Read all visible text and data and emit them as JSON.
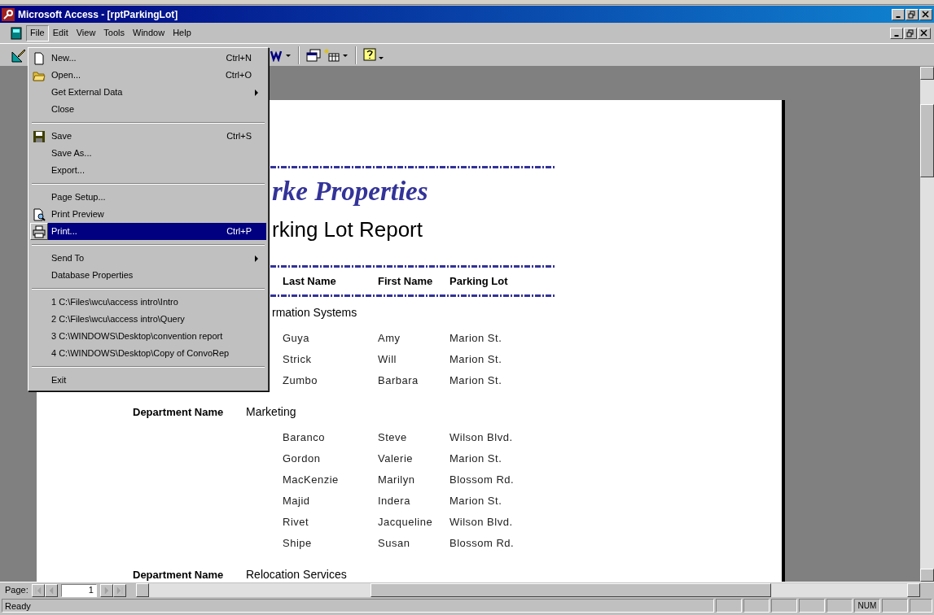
{
  "window": {
    "title": "Microsoft Access - [rptParkingLot]"
  },
  "menubar": [
    {
      "label": "File",
      "selected": true
    },
    {
      "label": "Edit",
      "selected": false
    },
    {
      "label": "View",
      "selected": false
    },
    {
      "label": "Tools",
      "selected": false
    },
    {
      "label": "Window",
      "selected": false
    },
    {
      "label": "Help",
      "selected": false
    }
  ],
  "file_menu": [
    {
      "kind": "item",
      "label": "New...",
      "shortcut": "Ctrl+N",
      "selected": false
    },
    {
      "kind": "item",
      "label": "Open...",
      "shortcut": "Ctrl+O",
      "selected": false
    },
    {
      "kind": "item",
      "label": "Get External Data",
      "submenu": true,
      "selected": false
    },
    {
      "kind": "item",
      "label": "Close",
      "selected": false
    },
    {
      "kind": "separator"
    },
    {
      "kind": "item",
      "label": "Save",
      "shortcut": "Ctrl+S",
      "selected": false
    },
    {
      "kind": "item",
      "label": "Save As...",
      "selected": false
    },
    {
      "kind": "item",
      "label": "Export...",
      "selected": false
    },
    {
      "kind": "separator"
    },
    {
      "kind": "item",
      "label": "Page Setup...",
      "selected": false
    },
    {
      "kind": "item",
      "label": "Print Preview",
      "selected": false
    },
    {
      "kind": "item",
      "label": "Print...",
      "shortcut": "Ctrl+P",
      "selected": true
    },
    {
      "kind": "separator"
    },
    {
      "kind": "item",
      "label": "Send To",
      "submenu": true,
      "selected": false
    },
    {
      "kind": "item",
      "label": "Database Properties",
      "selected": false
    },
    {
      "kind": "separator"
    },
    {
      "kind": "item",
      "label": "1 C:\\Files\\wcu\\access intro\\Intro",
      "selected": false
    },
    {
      "kind": "item",
      "label": "2 C:\\Files\\wcu\\access intro\\Query",
      "selected": false
    },
    {
      "kind": "item",
      "label": "3 C:\\WINDOWS\\Desktop\\convention report",
      "selected": false
    },
    {
      "kind": "item",
      "label": "4 C:\\WINDOWS\\Desktop\\Copy of ConvoRep",
      "selected": false
    },
    {
      "kind": "separator"
    },
    {
      "kind": "item",
      "label": "Exit",
      "selected": false
    }
  ],
  "report": {
    "company": "rke Properties",
    "title": "rking Lot Report",
    "columns": [
      "Last Name",
      "First Name",
      "Parking Lot"
    ],
    "groups": [
      {
        "name": "rmation Systems",
        "rows": [
          [
            "Guya",
            "Amy",
            "Marion St."
          ],
          [
            "Strick",
            "Will",
            "Marion St."
          ],
          [
            "Zumbo",
            "Barbara",
            "Marion St."
          ]
        ]
      },
      {
        "label": "Department Name",
        "name": "Marketing",
        "rows": [
          [
            "Baranco",
            "Steve",
            "Wilson Blvd."
          ],
          [
            "Gordon",
            "Valerie",
            "Marion St."
          ],
          [
            "MacKenzie",
            "Marilyn",
            "Blossom Rd."
          ],
          [
            "Majid",
            "Indera",
            "Marion St."
          ],
          [
            "Rivet",
            "Jacqueline",
            "Wilson Blvd."
          ],
          [
            "Shipe",
            "Susan",
            "Blossom Rd."
          ]
        ]
      },
      {
        "label": "Department Name",
        "name": "Relocation Services"
      }
    ]
  },
  "navigation": {
    "label": "Page:",
    "page": "1",
    "buttons": [
      {
        "kind": "first",
        "disabled": true
      },
      {
        "kind": "previous",
        "disabled": true
      },
      {
        "kind": "next",
        "disabled": true
      },
      {
        "kind": "last",
        "disabled": true
      }
    ]
  },
  "status_bar": {
    "text": "Ready",
    "indicators": [
      {
        "label": "NUM"
      }
    ]
  }
}
